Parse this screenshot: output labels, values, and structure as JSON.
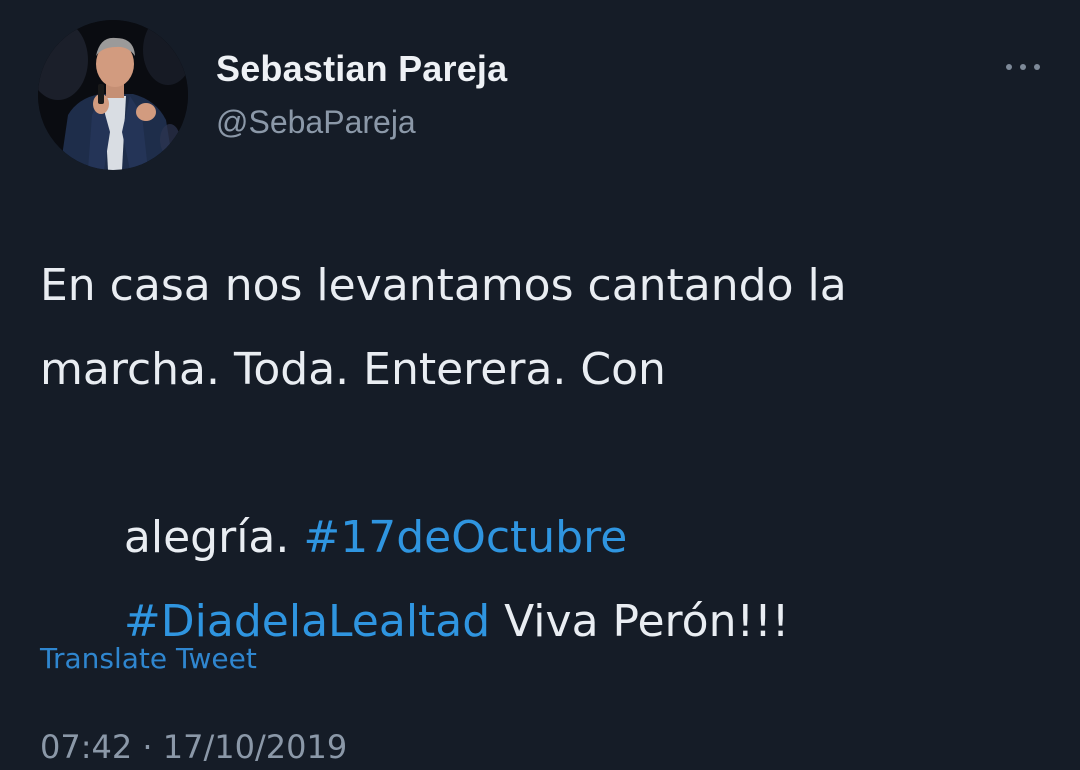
{
  "author": {
    "name": "Sebastian Pareja",
    "handle": "@SebaPareja"
  },
  "tweet": {
    "lines": [
      {
        "text": "En casa nos levantamos cantando la"
      },
      {
        "text": "marcha. Toda. Enterera. Con"
      },
      {
        "text": "alegría. ",
        "hashtag": "#17deOctubre"
      },
      {
        "hashtag": "#DiadelaLealtad",
        "text_after": " Viva Perón!!!"
      }
    ]
  },
  "actions": {
    "more_icon": "more-horizontal-icon",
    "translate_label": "Translate Tweet"
  },
  "meta": {
    "time": "07:42",
    "separator": " · ",
    "date": "17/10/2019"
  },
  "colors": {
    "background": "#151c27",
    "text": "#e9edf2",
    "secondary_text": "#8b98a8",
    "link": "#2f95e0"
  }
}
